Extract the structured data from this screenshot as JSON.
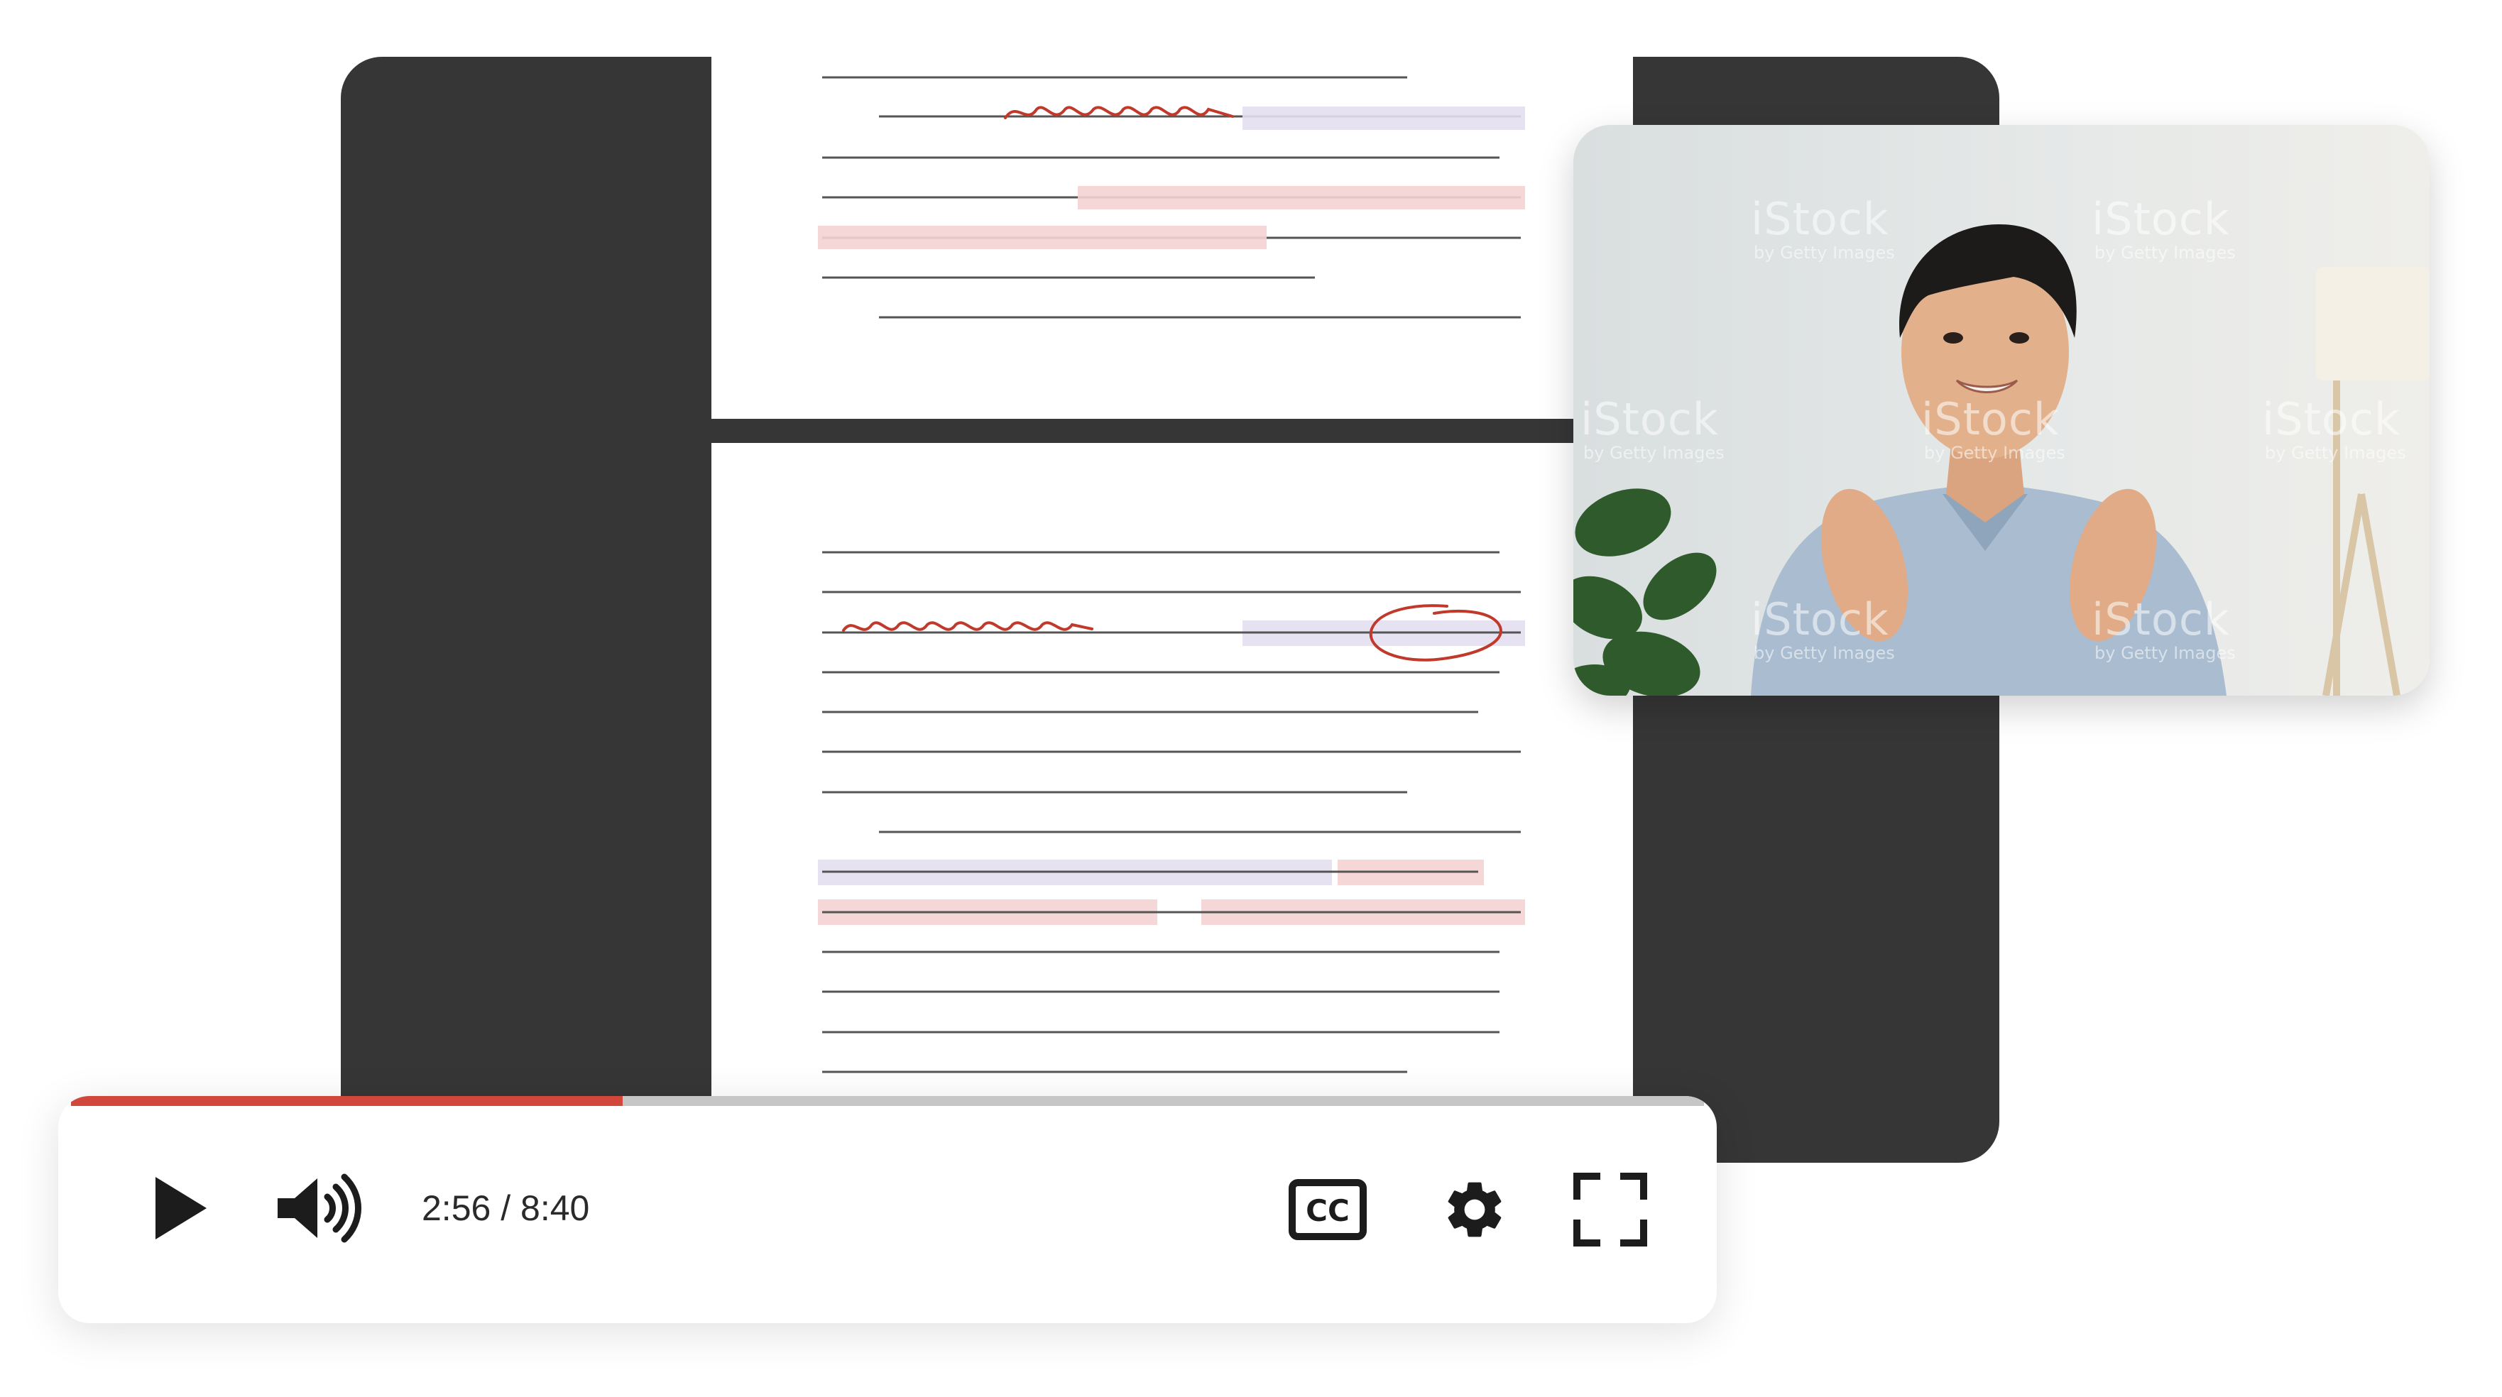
{
  "player": {
    "current_time": "2:56",
    "separator": " / ",
    "duration": "8:40",
    "progress_fraction": 0.338,
    "colors": {
      "progress": "#d2473b",
      "track": "#c6c6c6",
      "icon": "#1c1c1c"
    },
    "icons": {
      "play": "play-icon",
      "volume": "volume-icon",
      "captions": "closed-captions-icon",
      "settings": "gear-icon",
      "fullscreen": "fullscreen-icon"
    },
    "captions_label": "CC"
  },
  "video_tile": {
    "watermark_text": "iStock",
    "watermark_subtext": "by Getty Images"
  },
  "document": {
    "highlight_colors": {
      "purple": "#e3dff0",
      "red": "#f4d3d3",
      "ink": "#c0392b"
    }
  }
}
